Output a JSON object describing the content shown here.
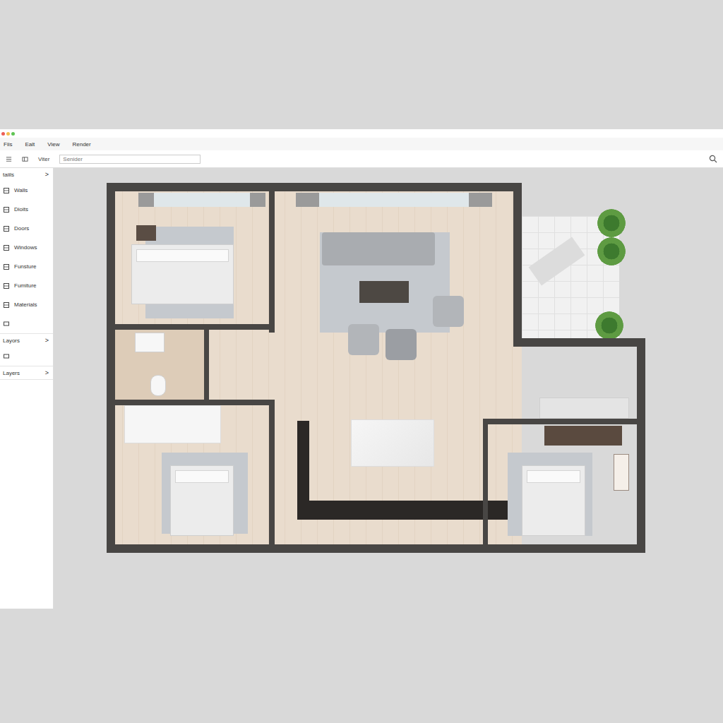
{
  "window": {
    "controls": [
      {
        "color": "#ec5f57"
      },
      {
        "color": "#f4bd4f"
      },
      {
        "color": "#5fc454"
      }
    ]
  },
  "menu": [
    "Fiis",
    "Ealt",
    "View",
    "Render"
  ],
  "toolbar": {
    "label": "Viter",
    "search": {
      "placeholder": "Senider"
    }
  },
  "sidebar": {
    "sections": [
      {
        "title": "taiils",
        "chevron": ">",
        "items": [
          "Walls",
          "Dioits",
          "Doors",
          "Windows",
          "Funsture",
          "Fumiture",
          "Materials"
        ]
      },
      {
        "title": "Layors",
        "chevron": ">",
        "items": []
      },
      {
        "title": "Layers",
        "chevron": ">",
        "items": []
      }
    ]
  }
}
